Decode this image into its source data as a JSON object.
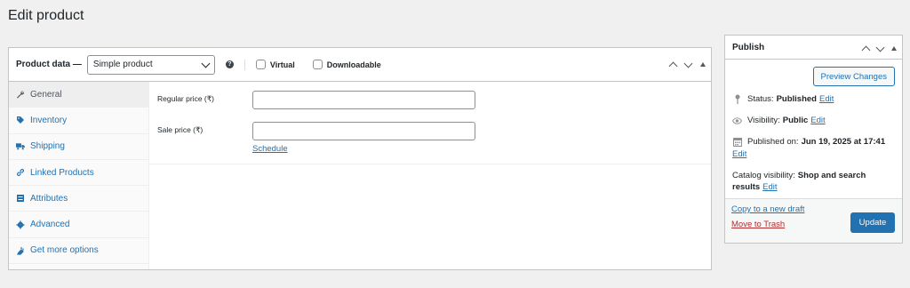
{
  "page": {
    "title": "Edit product"
  },
  "product_data": {
    "title": "Product data —",
    "product_type": "Simple product",
    "virtual_label": "Virtual",
    "downloadable_label": "Downloadable",
    "tabs": [
      {
        "label": "General",
        "icon": "wrench-icon",
        "active": true
      },
      {
        "label": "Inventory",
        "icon": "tag-icon"
      },
      {
        "label": "Shipping",
        "icon": "truck-icon"
      },
      {
        "label": "Linked Products",
        "icon": "link-icon"
      },
      {
        "label": "Attributes",
        "icon": "list-icon"
      },
      {
        "label": "Advanced",
        "icon": "gear-icon"
      },
      {
        "label": "Get more options",
        "icon": "plug-icon"
      }
    ],
    "general": {
      "regular_price_label": "Regular price (₹)",
      "regular_price_value": "",
      "sale_price_label": "Sale price (₹)",
      "sale_price_value": "",
      "schedule_link": "Schedule"
    }
  },
  "publish": {
    "title": "Publish",
    "preview_button": "Preview Changes",
    "status_label": "Status:",
    "status_value": "Published",
    "visibility_label": "Visibility:",
    "visibility_value": "Public",
    "published_on_label": "Published on:",
    "published_on_value": "Jun 19, 2025 at 17:41",
    "catalog_visibility_label": "Catalog visibility:",
    "catalog_visibility_value_1": "Shop and search",
    "catalog_visibility_value_2": "results",
    "edit_label": "Edit",
    "copy_draft": "Copy to a new draft",
    "move_trash": "Move to Trash",
    "update_button": "Update"
  },
  "colors": {
    "accent": "#2271b1",
    "danger": "#b32d2e",
    "background": "#f0f0f1"
  }
}
